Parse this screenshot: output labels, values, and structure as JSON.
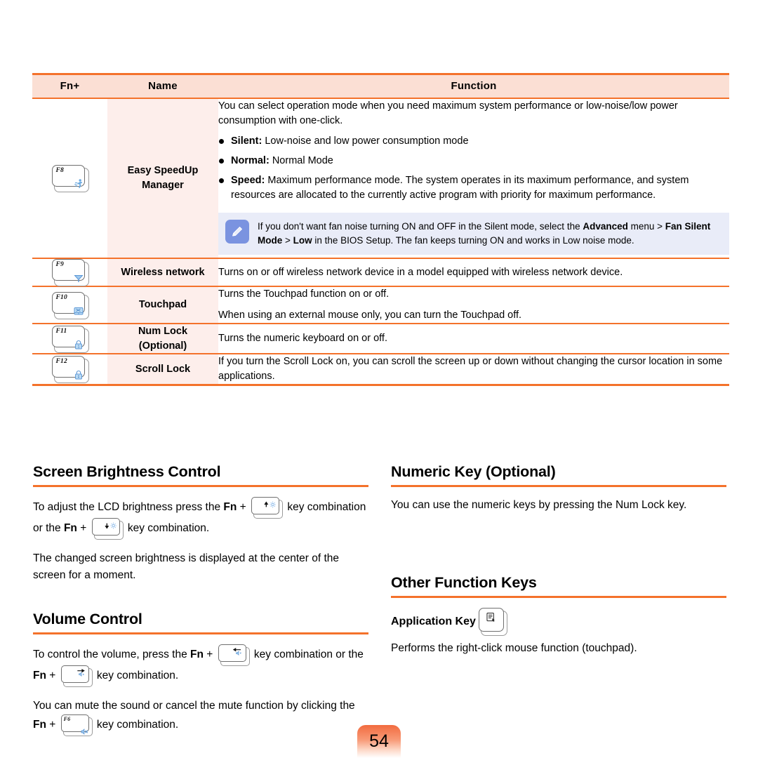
{
  "table": {
    "headers": {
      "key": "Fn+",
      "name": "Name",
      "function": "Function"
    },
    "rows": [
      {
        "key_label": "F8",
        "key_icon": "runner-icon",
        "name": "Easy SpeedUp\nManager",
        "name_line1": "Easy SpeedUp",
        "name_line2": "Manager",
        "intro": "You can select operation mode when you need maximum system performance or low-noise/low power consumption with one-click.",
        "bullets": [
          {
            "term": "Silent:",
            "text": " Low-noise and low power consumption mode"
          },
          {
            "term": "Normal:",
            "text": " Normal Mode"
          },
          {
            "term": "Speed:",
            "text": " Maximum performance mode. The system operates in its maximum performance, and system resources are allocated to the currently active program with priority for maximum performance."
          }
        ],
        "note": {
          "icon": "pencil-note-icon",
          "part1": "If you don't want fan noise turning ON and OFF in the Silent mode, select the ",
          "bold1": "Advanced",
          "part2": " menu > ",
          "bold2": "Fan Silent Mode",
          "part3": " > ",
          "bold3": "Low",
          "part4": " in the BIOS Setup. The fan keeps turning ON and works in Low noise mode."
        }
      },
      {
        "key_label": "F9",
        "key_icon": "wireless-antenna-icon",
        "name": "Wireless network",
        "desc1": "Turns on or off wireless network device in a model equipped with wireless network device."
      },
      {
        "key_label": "F10",
        "key_icon": "touchpad-icon",
        "name": "Touchpad",
        "desc1": "Turns the Touchpad function on or off.",
        "desc2": "When using an external mouse only, you can turn the Touchpad off."
      },
      {
        "key_label": "F11",
        "key_icon": "numlock-padlock-icon",
        "name_line1": "Num Lock",
        "name_line2": "(Optional)",
        "desc1": "Turns the numeric keyboard on or off."
      },
      {
        "key_label": "F12",
        "key_icon": "scrolllock-padlock-icon",
        "name": "Scroll Lock",
        "desc1": "If you turn the Scroll Lock on, you can scroll the screen up or down without changing the cursor location in some applications."
      }
    ]
  },
  "sections": {
    "brightness": {
      "title": "Screen Brightness Control",
      "p1_a": "To adjust the LCD brightness press the ",
      "p1_fn": "Fn",
      "p1_plus": " + ",
      "p1_b": " key combination or the ",
      "p1_fn2": "Fn",
      "p1_c": " key combination.",
      "p2": "The changed screen brightness is displayed at the center of the screen for a moment.",
      "key_up_icon": "brightness-up-key",
      "key_down_icon": "brightness-down-key"
    },
    "volume": {
      "title": "Volume Control",
      "p1_a": "To control the volume, press the ",
      "p1_fn": "Fn",
      "p1_b": " key combination or the ",
      "p1_c": " key combination.",
      "p2_a": "You can mute the sound or cancel the mute function by clicking the ",
      "p2_fn": "Fn",
      "p2_b": " key combination.",
      "key_down_icon": "volume-down-key",
      "key_up_icon": "volume-up-key",
      "key_mute_label": "F6",
      "key_mute_icon": "mute-speaker-icon"
    },
    "numeric": {
      "title": "Numeric Key (Optional)",
      "p1": "You can use the numeric keys by pressing the Num Lock key."
    },
    "other": {
      "title": "Other Function Keys",
      "app_key_label": "Application Key",
      "app_key_icon": "application-menu-icon",
      "p1": "Performs the right-click mouse function (touchpad)."
    }
  },
  "page_number": "54",
  "colors": {
    "accent": "#f4722b",
    "header_bg": "#fbdfd4",
    "name_col_bg": "#fdeeeb",
    "note_bg": "#e9ecf8",
    "note_icon_bg": "#7a93e0",
    "key_glyph_blue": "#7fb3e8"
  }
}
